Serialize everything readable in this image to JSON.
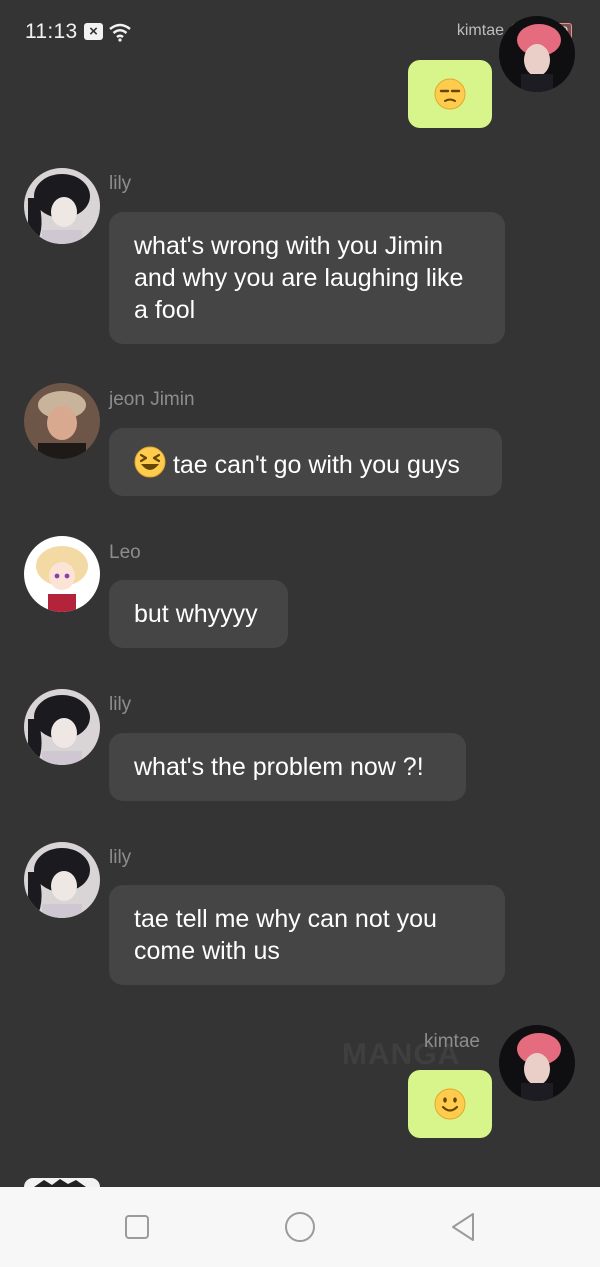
{
  "status_bar": {
    "time": "11:13",
    "overlay_name": "kimtae",
    "battery_level": "69"
  },
  "messages": [
    {
      "sender": "lily",
      "text": "what's wrong with you Jimin and why you are laughing like a fool"
    },
    {
      "sender": "jeon Jimin",
      "emoji": "laughing-face-icon",
      "text": "tae can't go with you guys"
    },
    {
      "sender": "Leo",
      "text": "but whyyyy"
    },
    {
      "sender": "lily",
      "text": "what's the problem now ?!"
    },
    {
      "sender": "lily",
      "text": "tae tell me why can not you come with us"
    }
  ],
  "own_messages": [
    {
      "sender": "kimtae",
      "emoji": "unamused-face-icon"
    },
    {
      "sender": "kimtae",
      "emoji": "slightly-smiling-face-icon"
    }
  ],
  "watermark": "MANGA",
  "colors": {
    "background": "#343434",
    "bubble": "#454545",
    "own_bubble": "#d7f58a",
    "name_text": "#8d8d8d",
    "nav_bar": "#f7f7f7"
  }
}
